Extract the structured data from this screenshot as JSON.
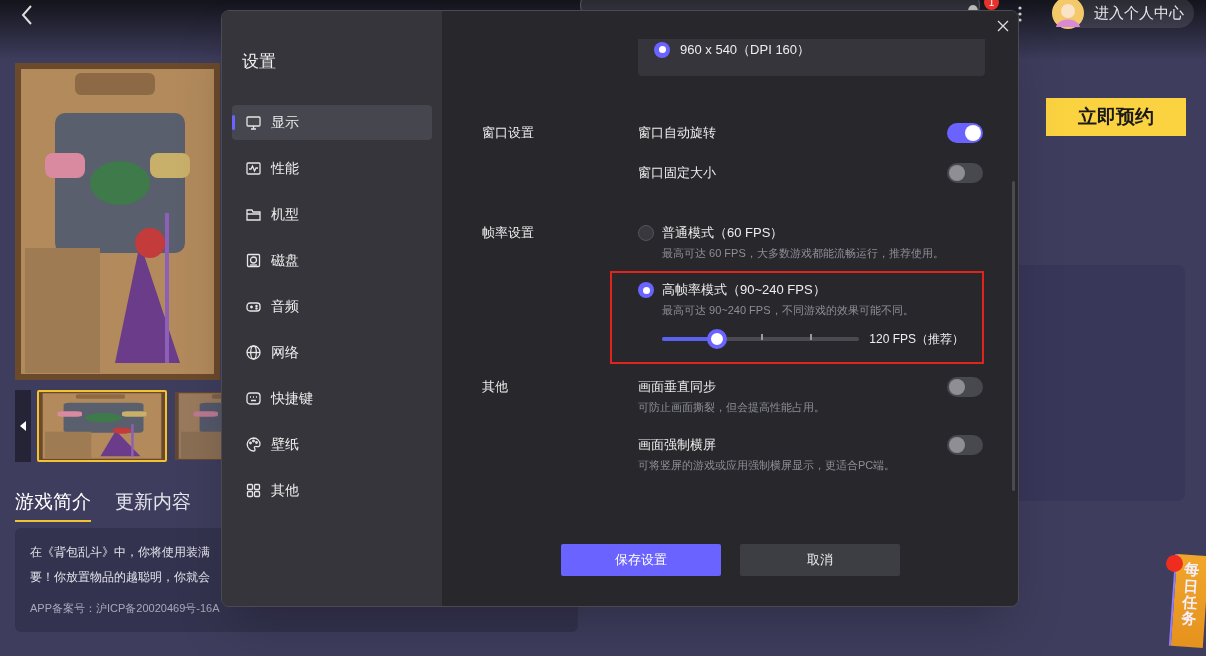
{
  "top_bar": {
    "notification_badge": "1",
    "profile_label": "进入个人中心"
  },
  "game": {
    "thumbnails": [
      {
        "selected": true
      },
      {
        "selected": false
      }
    ],
    "tabs": [
      {
        "label": "游戏简介",
        "selected": true
      },
      {
        "label": "更新内容",
        "selected": false
      }
    ],
    "description_lines": [
      "在《背包乱斗》中，你将使用装满",
      "要！你放置物品的越聪明，你就会"
    ],
    "record": "APP备案号：沪ICP备20020469号-16A",
    "reserve_button": "立即预约",
    "daily_task": "每日任务"
  },
  "dialog": {
    "title": "设置",
    "nav": [
      {
        "label": "显示",
        "selected": true
      },
      {
        "label": "性能",
        "selected": false
      },
      {
        "label": "机型",
        "selected": false
      },
      {
        "label": "磁盘",
        "selected": false
      },
      {
        "label": "音频",
        "selected": false
      },
      {
        "label": "网络",
        "selected": false
      },
      {
        "label": "快捷键",
        "selected": false
      },
      {
        "label": "壁纸",
        "selected": false
      },
      {
        "label": "其他",
        "selected": false
      }
    ],
    "resolution_option": {
      "label": "960 x 540（DPI 160）",
      "selected": true
    },
    "sections": [
      {
        "label": "窗口设置",
        "rows": [
          {
            "kind": "toggle",
            "label": "窗口自动旋转",
            "on": true
          },
          {
            "kind": "toggle",
            "label": "窗口固定大小",
            "on": false
          }
        ]
      },
      {
        "label": "帧率设置",
        "rows": [
          {
            "kind": "radio",
            "label": "普通模式（60 FPS）",
            "hint": "最高可达 60 FPS，大多数游戏都能流畅运行，推荐使用。",
            "selected": false,
            "highlighted": false
          },
          {
            "kind": "radio",
            "label": "高帧率模式（90~240 FPS）",
            "hint": "最高可达 90~240 FPS，不同游戏的效果可能不同。",
            "selected": true,
            "highlighted": true,
            "slider": {
              "level": 0.28,
              "reading": "120 FPS（推荐）"
            }
          }
        ]
      },
      {
        "label": "其他",
        "rows": [
          {
            "kind": "toggle",
            "label": "画面垂直同步",
            "hint": "可防止画面撕裂，但会提高性能占用。",
            "on": false
          },
          {
            "kind": "toggle",
            "label": "画面强制横屏",
            "hint": "可将竖屏的游戏或应用强制横屏显示，更适合PC端。",
            "on": false
          }
        ]
      }
    ],
    "buttons": [
      {
        "label": "保存设置",
        "kind": "primary"
      },
      {
        "label": "取消",
        "kind": "secondary"
      }
    ]
  }
}
